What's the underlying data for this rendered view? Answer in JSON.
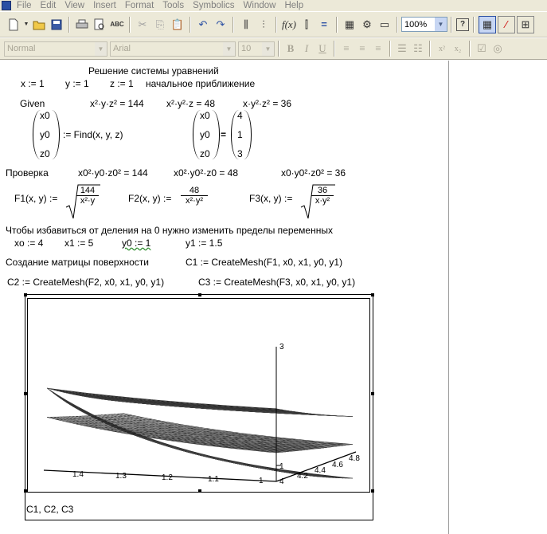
{
  "menu": [
    "File",
    "Edit",
    "View",
    "Insert",
    "Format",
    "Tools",
    "Symbolics",
    "Window",
    "Help"
  ],
  "toolbar": {
    "zoom": "100%",
    "help_label": "?"
  },
  "format_bar": {
    "style": "Normal",
    "font": "Arial",
    "size": "10"
  },
  "doc": {
    "title": "Решение системы уравнений",
    "init": {
      "x": "x := 1",
      "y": "y := 1",
      "z": "z := 1",
      "note": "начальное приближение"
    },
    "given": "Given",
    "eq1": "x²·y·z² = 144",
    "eq2": "x²·y²·z = 48",
    "eq3": "x·y²·z² = 36",
    "vec_vars": [
      "x0",
      "y0",
      "z0"
    ],
    "find": ":= Find(x, y, z)",
    "result": [
      "4",
      "1",
      "3"
    ],
    "check_label": "Проверка",
    "check1": "x0²·y0·z0² = 144",
    "check2": "x0²·y0²·z0 = 48",
    "check3": "x0·y0²·z0² = 36",
    "f1": {
      "lhs": "F1(x, y) :=",
      "num": "144",
      "den": "x²·y"
    },
    "f2": {
      "lhs": "F2(x, y) :=",
      "num": "48",
      "den": "x²·y²"
    },
    "f3": {
      "lhs": "F3(x, y) :=",
      "num": "36",
      "den": "x·y²"
    },
    "note2": "Чтобы избавиться от деления на 0 нужно изменить пределы переменных",
    "limits": {
      "x0": "xo := 4",
      "x1": "x1 := 5",
      "y0": "y0 := 1",
      "y1": "y1 := 1.5"
    },
    "mesh_label": "Создание матрицы поверхности",
    "c1": "C1 := CreateMesh(F1, x0, x1, y0, y1)",
    "c2": "C2 := CreateMesh(F2, x0, x1, y0, y1)",
    "c3": "C3 := CreateMesh(F3, x0, x1, y0, y1)",
    "plot_caption": "C1, C2, C3",
    "plot_ticks_y": [
      "1.4",
      "1.3",
      "1.2",
      "1.1",
      "1"
    ],
    "plot_ticks_x": [
      "4",
      "4.2",
      "4.4",
      "4.6",
      "4.8"
    ],
    "plot_ticks_z": [
      "3",
      "1"
    ]
  }
}
